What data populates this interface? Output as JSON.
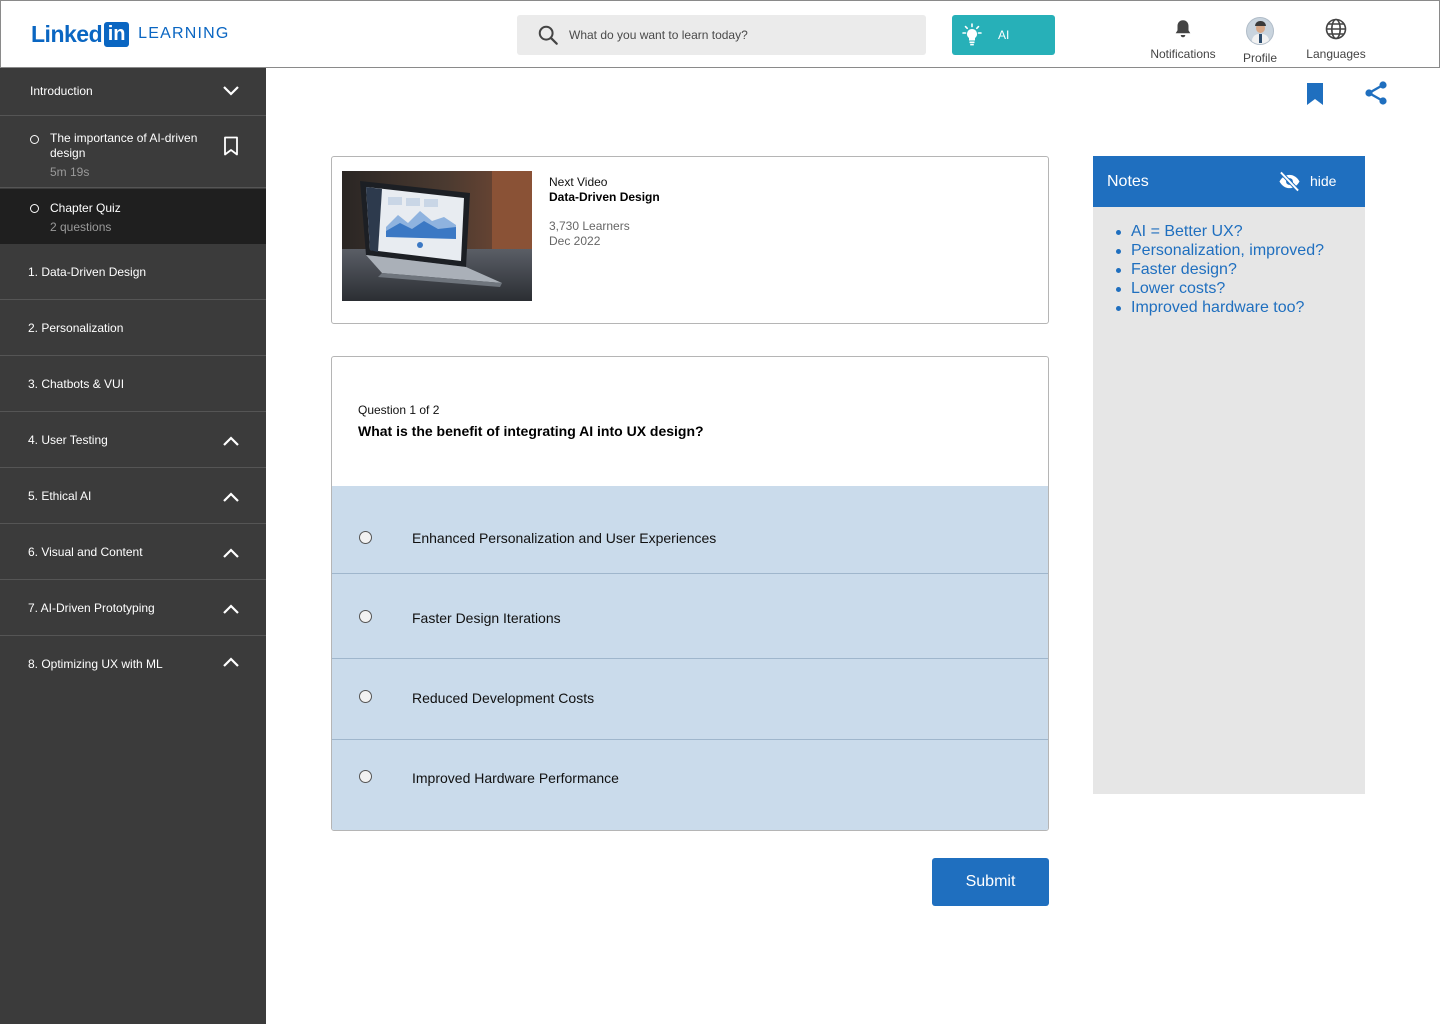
{
  "header": {
    "logo_linked": "Linked",
    "logo_in": "in",
    "logo_product": "LEARNING",
    "search_placeholder": "What do you want to learn today?",
    "ai_button_label": "AI",
    "nav": {
      "notifications": "Notifications",
      "profile": "Profile",
      "languages": "Languages"
    }
  },
  "sidebar": {
    "intro_label": "Introduction",
    "lesson": {
      "title": "The importance of AI-driven design",
      "duration": "5m 19s"
    },
    "quiz": {
      "title": "Chapter Quiz",
      "meta": "2 questions"
    },
    "chapters": [
      {
        "label": "1. Data-Driven Design",
        "chevron": "none"
      },
      {
        "label": "2. Personalization",
        "chevron": "none"
      },
      {
        "label": "3. Chatbots & VUI",
        "chevron": "none"
      },
      {
        "label": "4. User Testing",
        "chevron": "up"
      },
      {
        "label": "5. Ethical AI",
        "chevron": "up"
      },
      {
        "label": "6. Visual and Content",
        "chevron": "up"
      },
      {
        "label": "7. AI-Driven Prototyping",
        "chevron": "up"
      },
      {
        "label": "8. Optimizing UX with ML",
        "chevron": "up"
      }
    ]
  },
  "next_video": {
    "label": "Next Video",
    "title": "Data-Driven Design",
    "learners": "3,730 Learners",
    "date": "Dec 2022"
  },
  "quiz": {
    "count": "Question 1 of 2",
    "question": "What is the benefit of integrating AI into UX design?",
    "options": [
      "Enhanced Personalization and User Experiences",
      "Faster Design Iterations",
      "Reduced Development Costs",
      "Improved Hardware Performance"
    ],
    "submit_label": "Submit"
  },
  "notes": {
    "title": "Notes",
    "hide_label": "hide",
    "items": [
      "AI = Better UX?",
      "Personalization, improved?",
      "Faster design?",
      "Lower costs?",
      "Improved hardware too?"
    ]
  },
  "colors": {
    "brand_blue": "#0a66c2",
    "accent_blue": "#1f6fbf",
    "ai_teal": "#27b0b8",
    "sidebar_bg": "#3b3b3b",
    "option_bg": "#cadbeb"
  },
  "icons": {
    "search": "search-icon",
    "ai": "lightbulb-icon",
    "notifications": "bell-icon",
    "languages": "globe-icon",
    "bookmark": "bookmark-icon",
    "share": "share-icon",
    "hide": "eye-off-icon",
    "chevron_down": "chevron-down-icon",
    "chevron_up": "chevron-up-icon"
  }
}
